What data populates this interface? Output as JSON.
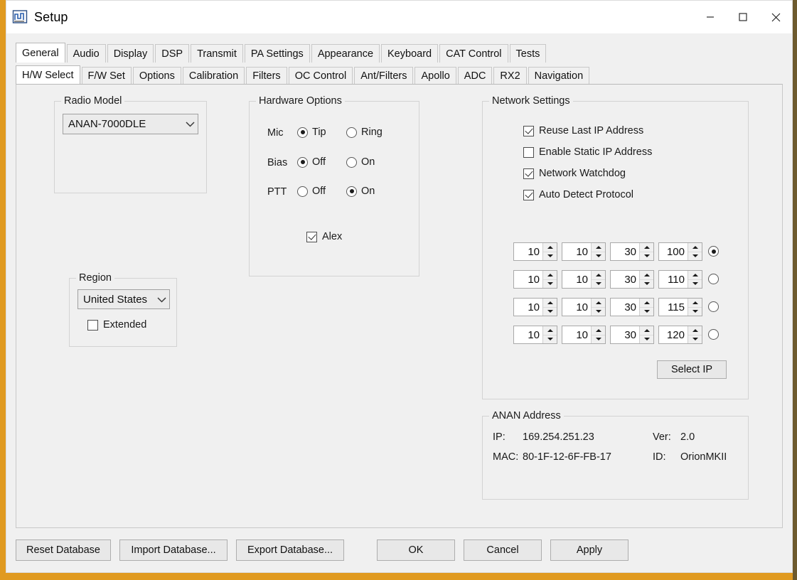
{
  "window": {
    "title": "Setup",
    "icon": "waveform-icon",
    "controls": {
      "minimize": "minimize-icon",
      "maximize": "maximize-icon",
      "close": "close-icon"
    }
  },
  "tabs_outer": [
    {
      "label": "General",
      "active": true
    },
    {
      "label": "Audio",
      "active": false
    },
    {
      "label": "Display",
      "active": false
    },
    {
      "label": "DSP",
      "active": false
    },
    {
      "label": "Transmit",
      "active": false
    },
    {
      "label": "PA Settings",
      "active": false
    },
    {
      "label": "Appearance",
      "active": false
    },
    {
      "label": "Keyboard",
      "active": false
    },
    {
      "label": "CAT Control",
      "active": false
    },
    {
      "label": "Tests",
      "active": false
    }
  ],
  "tabs_inner": [
    {
      "label": "H/W Select",
      "active": true
    },
    {
      "label": "F/W Set",
      "active": false
    },
    {
      "label": "Options",
      "active": false
    },
    {
      "label": "Calibration",
      "active": false
    },
    {
      "label": "Filters",
      "active": false
    },
    {
      "label": "OC Control",
      "active": false
    },
    {
      "label": "Ant/Filters",
      "active": false
    },
    {
      "label": "Apollo",
      "active": false
    },
    {
      "label": "ADC",
      "active": false
    },
    {
      "label": "RX2",
      "active": false
    },
    {
      "label": "Navigation",
      "active": false
    }
  ],
  "radio_model": {
    "legend": "Radio Model",
    "value": "ANAN-7000DLE"
  },
  "region": {
    "legend": "Region",
    "value": "United States",
    "extended": {
      "label": "Extended",
      "checked": false
    }
  },
  "hardware_options": {
    "legend": "Hardware Options",
    "rows": [
      {
        "label": "Mic",
        "options": [
          {
            "label": "Tip",
            "selected": true
          },
          {
            "label": "Ring",
            "selected": false
          }
        ]
      },
      {
        "label": "Bias",
        "options": [
          {
            "label": "Off",
            "selected": true
          },
          {
            "label": "On",
            "selected": false
          }
        ]
      },
      {
        "label": "PTT",
        "options": [
          {
            "label": "Off",
            "selected": false
          },
          {
            "label": "On",
            "selected": true
          }
        ]
      }
    ],
    "alex": {
      "label": "Alex",
      "checked": true
    }
  },
  "network_settings": {
    "legend": "Network Settings",
    "checkboxes": [
      {
        "label": "Reuse Last IP Address",
        "checked": true
      },
      {
        "label": "Enable Static IP Address",
        "checked": false
      },
      {
        "label": "Network Watchdog",
        "checked": true
      },
      {
        "label": "Auto Detect Protocol",
        "checked": true
      }
    ],
    "ip_rows": [
      {
        "octets": [
          "10",
          "10",
          "30",
          "100"
        ],
        "selected": true
      },
      {
        "octets": [
          "10",
          "10",
          "30",
          "110"
        ],
        "selected": false
      },
      {
        "octets": [
          "10",
          "10",
          "30",
          "115"
        ],
        "selected": false
      },
      {
        "octets": [
          "10",
          "10",
          "30",
          "120"
        ],
        "selected": false
      }
    ],
    "select_ip_button": "Select IP"
  },
  "anan_address": {
    "legend": "ANAN Address",
    "ip_label": "IP:",
    "ip_value": "169.254.251.23",
    "ver_label": "Ver:",
    "ver_value": "2.0",
    "mac_label": "MAC:",
    "mac_value": "80-1F-12-6F-FB-17",
    "id_label": "ID:",
    "id_value": "OrionMKII"
  },
  "bottom_buttons": [
    {
      "label": "Reset Database",
      "name": "reset-database-button",
      "width": 134,
      "gap": 12
    },
    {
      "label": "Import Database...",
      "name": "import-database-button",
      "width": 152,
      "gap": 12
    },
    {
      "label": "Export Database...",
      "name": "export-database-button",
      "width": 152,
      "gap": 46
    },
    {
      "label": "OK",
      "name": "ok-button",
      "width": 110,
      "gap": 12
    },
    {
      "label": "Cancel",
      "name": "cancel-button",
      "width": 110,
      "gap": 12
    },
    {
      "label": "Apply",
      "name": "apply-button",
      "width": 110,
      "gap": 12
    }
  ],
  "colors": {
    "desktop": "#e09a20",
    "window_bg": "#f0f0f0",
    "titlebar": "#ffffff",
    "tab_active": "#ffffff",
    "field_bg": "#ffffff",
    "combo_bg": "#ebebeb"
  }
}
